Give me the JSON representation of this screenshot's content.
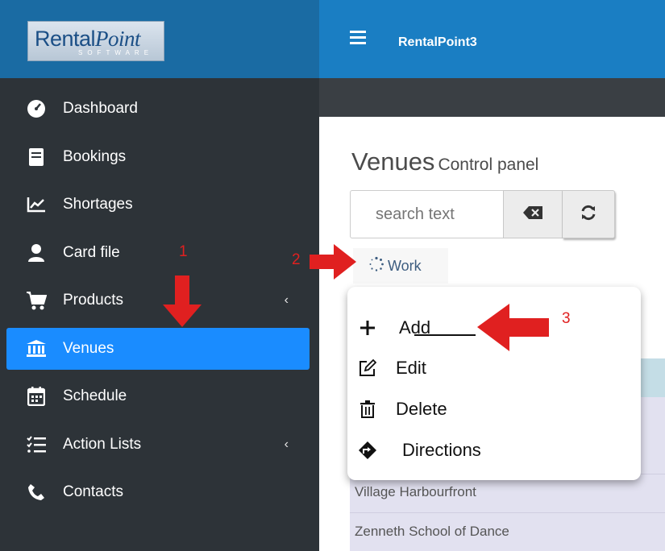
{
  "brand": {
    "logo_main": "Rental",
    "logo_italic": "Point",
    "logo_sub": "SOFTWARE"
  },
  "header": {
    "app_name": "RentalPoint3"
  },
  "sidebar": {
    "items": [
      {
        "label": "Dashboard",
        "icon": "dashboard-icon"
      },
      {
        "label": "Bookings",
        "icon": "book-icon"
      },
      {
        "label": "Shortages",
        "icon": "line-chart-icon"
      },
      {
        "label": "Card file",
        "icon": "user-icon"
      },
      {
        "label": "Products",
        "icon": "cart-icon",
        "caret": "‹"
      },
      {
        "label": "Venues",
        "icon": "bank-icon",
        "active": true
      },
      {
        "label": "Schedule",
        "icon": "calendar-icon"
      },
      {
        "label": "Action Lists",
        "icon": "list-icon",
        "caret": "‹"
      },
      {
        "label": "Contacts",
        "icon": "phone-icon"
      }
    ]
  },
  "main": {
    "title": "Venues",
    "subtitle": "Control panel",
    "search": {
      "placeholder": "search text"
    },
    "work_button": "Work",
    "rows": [
      "Village Harbourfront",
      "Zenneth School of Dance"
    ]
  },
  "dropdown": {
    "items": [
      {
        "label": "Add",
        "icon": "plus-icon"
      },
      {
        "label": "Edit",
        "icon": "edit-icon"
      },
      {
        "label": "Delete",
        "icon": "trash-icon"
      },
      {
        "label": "Directions",
        "icon": "directions-icon"
      }
    ]
  },
  "annotations": {
    "n1": "1",
    "n2": "2",
    "n3": "3"
  },
  "colors": {
    "accent": "#1a8cff",
    "header": "#1a7ec3",
    "sidebar": "#2d3338",
    "annotation": "#e02020"
  }
}
